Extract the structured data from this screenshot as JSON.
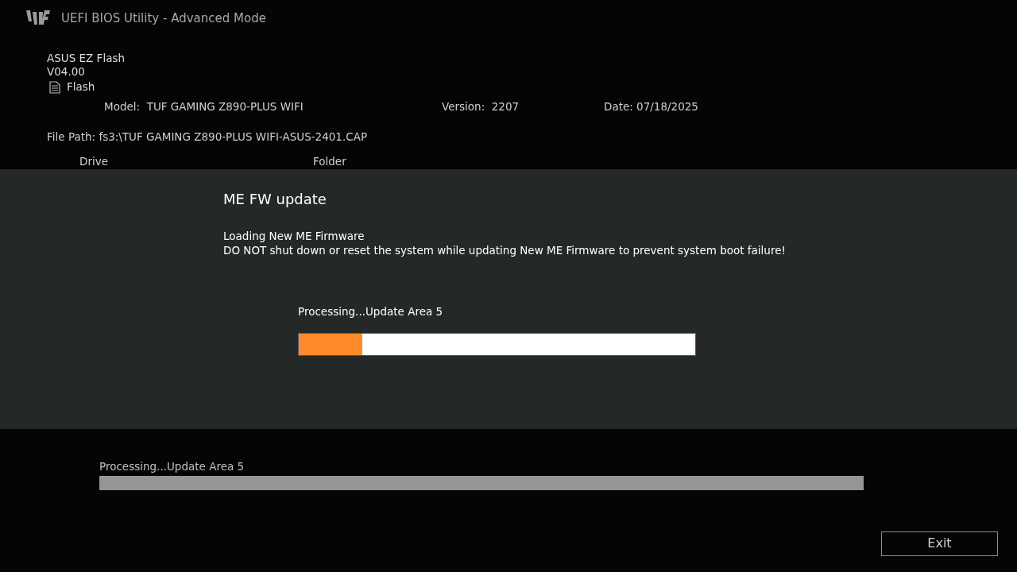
{
  "header": {
    "title": "UEFI BIOS Utility - Advanced Mode"
  },
  "app": {
    "name": "ASUS EZ Flash",
    "version": "V04.00",
    "mode": "Flash"
  },
  "info": {
    "model": "Model:  TUF GAMING Z890-PLUS WIFI",
    "version": "Version:  2207",
    "date": "Date: 07/18/2025",
    "file_path": "File Path: fs3:\\TUF GAMING Z890-PLUS WIFI-ASUS-2401.CAP"
  },
  "columns": [
    "Drive",
    "Folder"
  ],
  "dialog": {
    "title": "ME FW update",
    "lines": [
      "Loading New ME Firmware",
      "DO NOT shut down or reset the system while updating New ME Firmware to prevent system boot failure!"
    ],
    "status": "Processing...Update Area 5",
    "level": 0.16
  },
  "footer": {
    "status": "Processing...Update Area 5",
    "button": "Exit"
  }
}
